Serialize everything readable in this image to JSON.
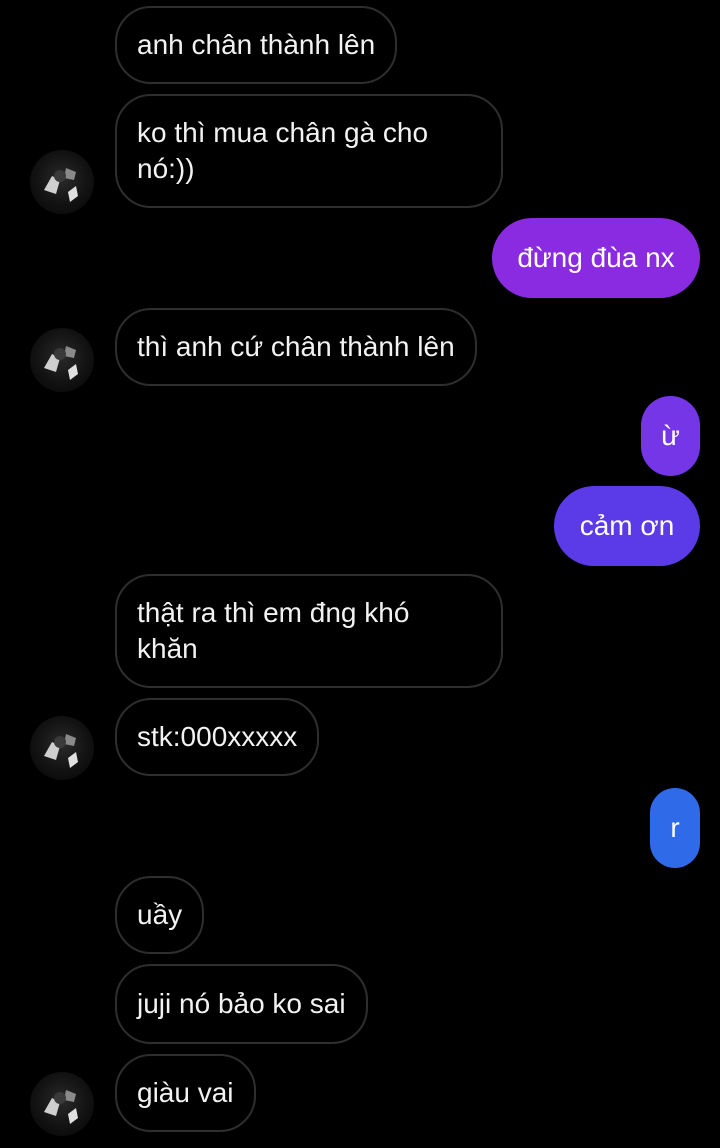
{
  "conversation": {
    "messages": [
      {
        "text": "anh chân thành lên"
      },
      {
        "text": "ko thì mua chân gà cho\nnó:))"
      },
      {
        "text": "đừng đùa nx"
      },
      {
        "text": "thì anh cứ chân thành lên"
      },
      {
        "text": "ừ"
      },
      {
        "text": "cảm ơn"
      },
      {
        "text": "thật ra thì em đng khó\nkhăn"
      },
      {
        "text": "stk:000xxxxx"
      },
      {
        "text": "r"
      },
      {
        "text": "uầy"
      },
      {
        "text": "juji nó bảo ko sai"
      },
      {
        "text": "giàu vai"
      }
    ]
  },
  "colors": {
    "background": "#000000",
    "incoming_border": "#2e2e2e",
    "outgoing_purple": "#8a2be2",
    "outgoing_indigo": "#5b3be8",
    "outgoing_blue": "#2f6ae8"
  },
  "icons": {
    "avatar": "contact-avatar-icon"
  }
}
